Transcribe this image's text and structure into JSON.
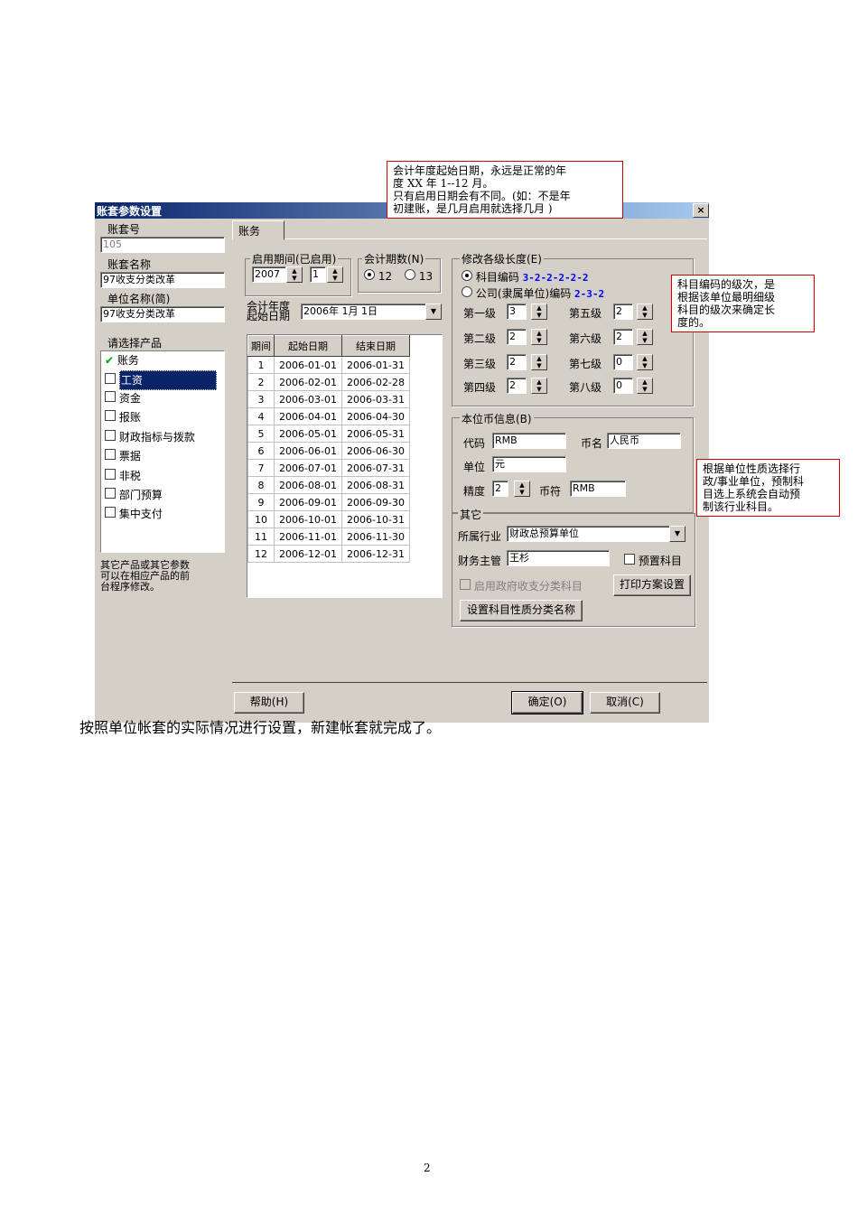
{
  "window": {
    "title": "账套参数设置",
    "close": "×"
  },
  "left": {
    "account_no_label": "账套号",
    "account_no_value": "105",
    "account_name_label": "账套名称",
    "account_name_value": "97收支分类改革",
    "unit_name_label": "单位名称(简)",
    "unit_name_value": "97收支分类改革",
    "product_label": "请选择产品",
    "products": [
      {
        "label": "账务",
        "checked": true
      },
      {
        "label": "工资",
        "checked": false
      },
      {
        "label": "资金",
        "checked": false
      },
      {
        "label": "报账",
        "checked": false
      },
      {
        "label": "财政指标与拨款",
        "checked": false
      },
      {
        "label": "票据",
        "checked": false
      },
      {
        "label": "非税",
        "checked": false
      },
      {
        "label": "部门预算",
        "checked": false
      },
      {
        "label": "集中支付",
        "checked": false
      }
    ],
    "hint": [
      "其它产品或其它参数",
      "可以在相应产品的前",
      "台程序修改。"
    ]
  },
  "tab": {
    "label": "账务"
  },
  "period": {
    "start_label": "启用期间(已启用)",
    "year": "2007",
    "month": "1",
    "count_label": "会计期数(N)",
    "opt12": "12",
    "opt13": "13",
    "fiscal_start_label1": "会计年度",
    "fiscal_start_label2": "起始日期",
    "fiscal_start_value": "2006年 1月 1日",
    "table_headers": [
      "期间",
      "起始日期",
      "结束日期"
    ],
    "rows": [
      [
        "1",
        "2006-01-01",
        "2006-01-31"
      ],
      [
        "2",
        "2006-02-01",
        "2006-02-28"
      ],
      [
        "3",
        "2006-03-01",
        "2006-03-31"
      ],
      [
        "4",
        "2006-04-01",
        "2006-04-30"
      ],
      [
        "5",
        "2006-05-01",
        "2006-05-31"
      ],
      [
        "6",
        "2006-06-01",
        "2006-06-30"
      ],
      [
        "7",
        "2006-07-01",
        "2006-07-31"
      ],
      [
        "8",
        "2006-08-01",
        "2006-08-31"
      ],
      [
        "9",
        "2006-09-01",
        "2006-09-30"
      ],
      [
        "10",
        "2006-10-01",
        "2006-10-31"
      ],
      [
        "11",
        "2006-11-01",
        "2006-11-30"
      ],
      [
        "12",
        "2006-12-01",
        "2006-12-31"
      ]
    ]
  },
  "levels": {
    "title": "修改各级长度(E)",
    "subject_code_label": "科目编码",
    "subject_code_value": "3-2-2-2-2-2",
    "company_code_label": "公司(隶属单位)编码",
    "company_code_value": "2-3-2",
    "items": [
      {
        "label": "第一级",
        "value": "3"
      },
      {
        "label": "第二级",
        "value": "2"
      },
      {
        "label": "第三级",
        "value": "2"
      },
      {
        "label": "第四级",
        "value": "2"
      },
      {
        "label": "第五级",
        "value": "2"
      },
      {
        "label": "第六级",
        "value": "2"
      },
      {
        "label": "第七级",
        "value": "0"
      },
      {
        "label": "第八级",
        "value": "0"
      }
    ]
  },
  "currency": {
    "title": "本位币信息(B)",
    "code_label": "代码",
    "code_value": "RMB",
    "name_label": "币名",
    "name_value": "人民币",
    "unit_label": "单位",
    "unit_value": "元",
    "precision_label": "精度",
    "precision_value": "2",
    "symbol_label": "币符",
    "symbol_value": "RMB"
  },
  "other": {
    "title": "其它",
    "industry_label": "所属行业",
    "industry_value": "财政总预算单位",
    "manager_label": "财务主管",
    "manager_value": "王杉",
    "preset_label": "预置科目",
    "gov_label": "启用政府收支分类科目",
    "print_button": "打印方案设置",
    "nature_button": "设置科目性质分类名称"
  },
  "buttons": {
    "help": "帮助(H)",
    "ok": "确定(O)",
    "cancel": "取消(C)"
  },
  "notes": {
    "top": [
      "会计年度起始日期，永远是正常的年",
      "度 XX 年 1--12 月。",
      "只有启用日期会有不同。(如：不是年",
      "初建账，是几月启用就选择几月 )"
    ],
    "right1": [
      "科目编码的级次，是",
      "根据该单位最明细级",
      "科目的级次来确定长",
      "度的。"
    ],
    "right2": [
      "根据单位性质选择行",
      "政/事业单位，预制科",
      "目选上系统会自动预",
      "制该行业科目。"
    ]
  },
  "body_text": "按照单位帐套的实际情况进行设置，新建帐套就完成了。",
  "page_number": "2"
}
